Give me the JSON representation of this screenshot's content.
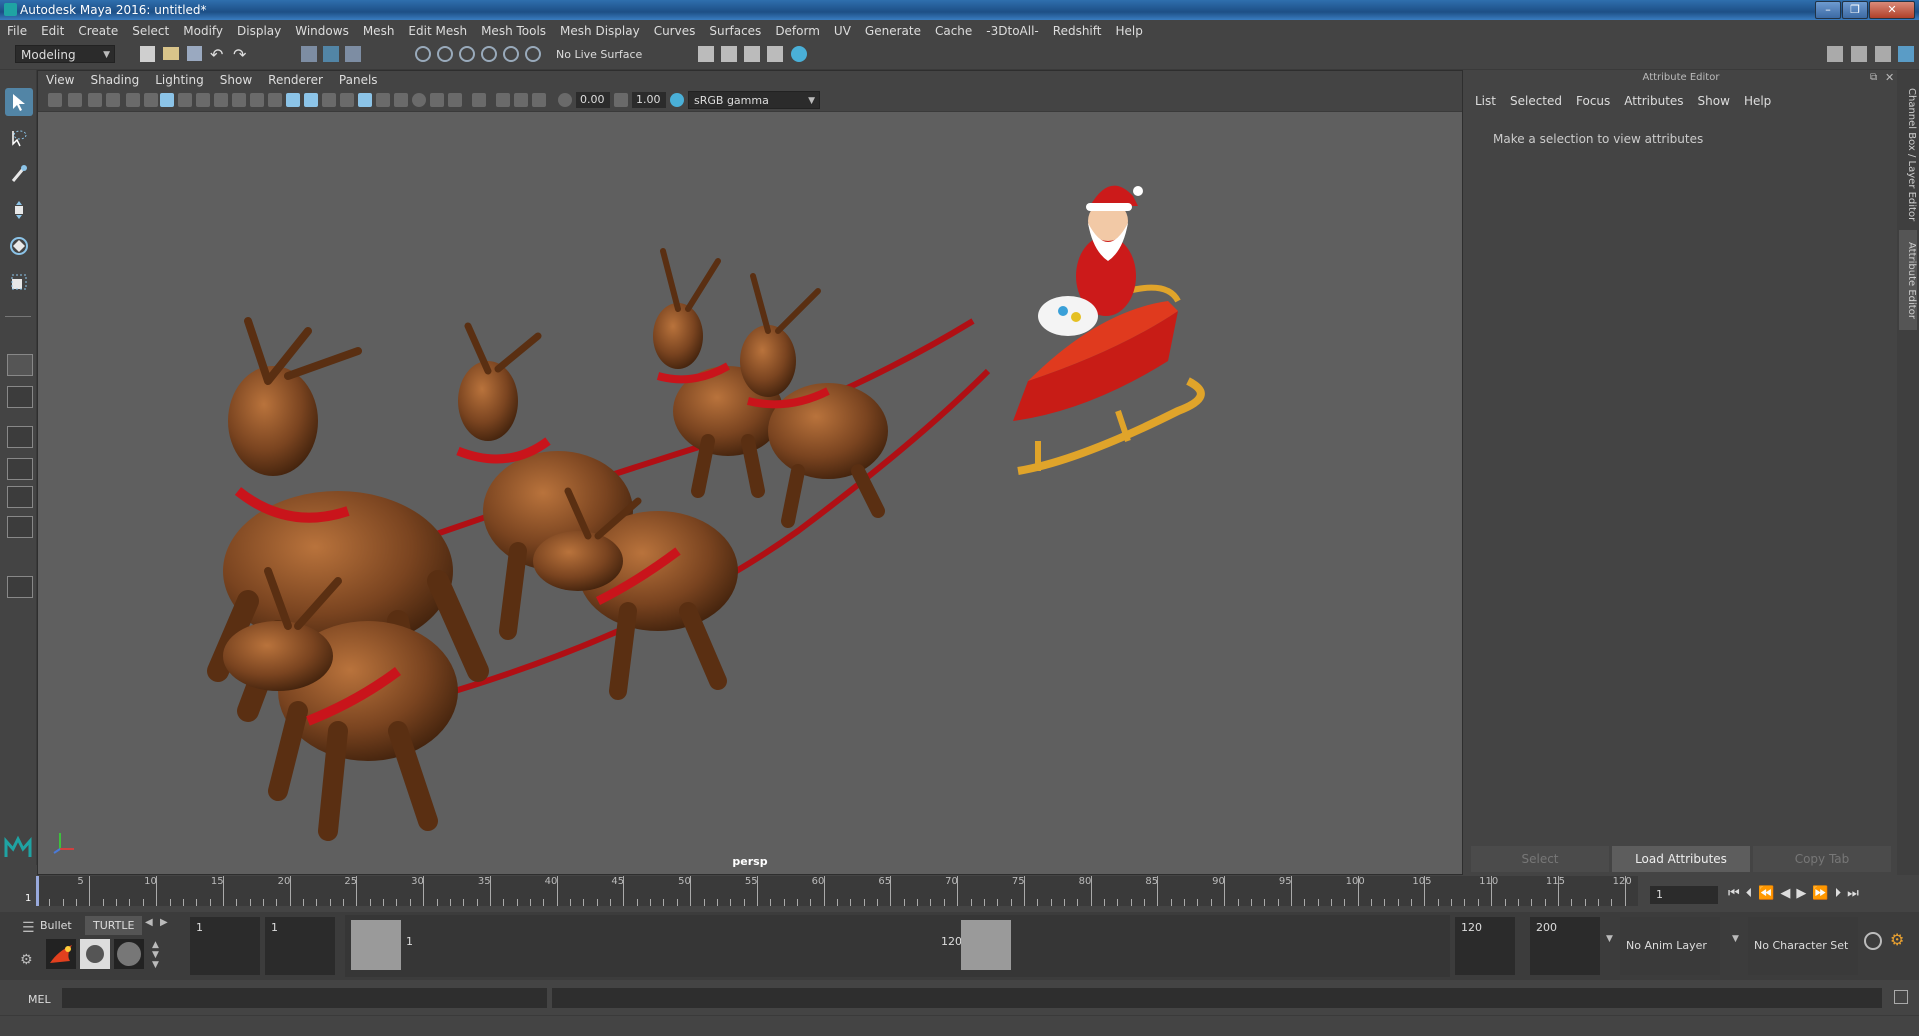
{
  "window": {
    "title": "Autodesk Maya 2016: untitled*"
  },
  "menubar": [
    "File",
    "Edit",
    "Create",
    "Select",
    "Modify",
    "Display",
    "Windows",
    "Mesh",
    "Edit Mesh",
    "Mesh Tools",
    "Mesh Display",
    "Curves",
    "Surfaces",
    "Deform",
    "UV",
    "Generate",
    "Cache",
    "-3DtoAll-",
    "Redshift",
    "Help"
  ],
  "status": {
    "mode": "Modeling",
    "live_surface": "No Live Surface"
  },
  "viewport": {
    "menu": [
      "View",
      "Shading",
      "Lighting",
      "Show",
      "Renderer",
      "Panels"
    ],
    "field_a": "0.00",
    "field_b": "1.00",
    "color_space": "sRGB gamma",
    "camera": "persp"
  },
  "attribute_editor": {
    "header": "Attribute Editor",
    "menu": [
      "List",
      "Selected",
      "Focus",
      "Attributes",
      "Show",
      "Help"
    ],
    "message": "Make a selection to view attributes",
    "buttons": {
      "select": "Select",
      "load": "Load Attributes",
      "copy": "Copy Tab"
    }
  },
  "side_tabs": {
    "channel": "Channel Box / Layer Editor",
    "attr": "Attribute Editor"
  },
  "timeline": {
    "ticks": [
      "5",
      "10",
      "15",
      "20",
      "25",
      "30",
      "35",
      "40",
      "45",
      "50",
      "55",
      "60",
      "65",
      "70",
      "75",
      "80",
      "85",
      "90",
      "95",
      "100",
      "105",
      "110",
      "115",
      "120"
    ],
    "current_frame_marker": "1",
    "current_frame_field": "1"
  },
  "range": {
    "shelf_tabs": {
      "bullet": "Bullet",
      "turtle": "TURTLE"
    },
    "start": "1",
    "playback_start": "1",
    "slider_start": "1",
    "slider_end": "120",
    "playback_end": "120",
    "end": "200",
    "anim_layer": "No Anim Layer",
    "character_set": "No Character Set"
  },
  "command": {
    "label": "MEL"
  }
}
